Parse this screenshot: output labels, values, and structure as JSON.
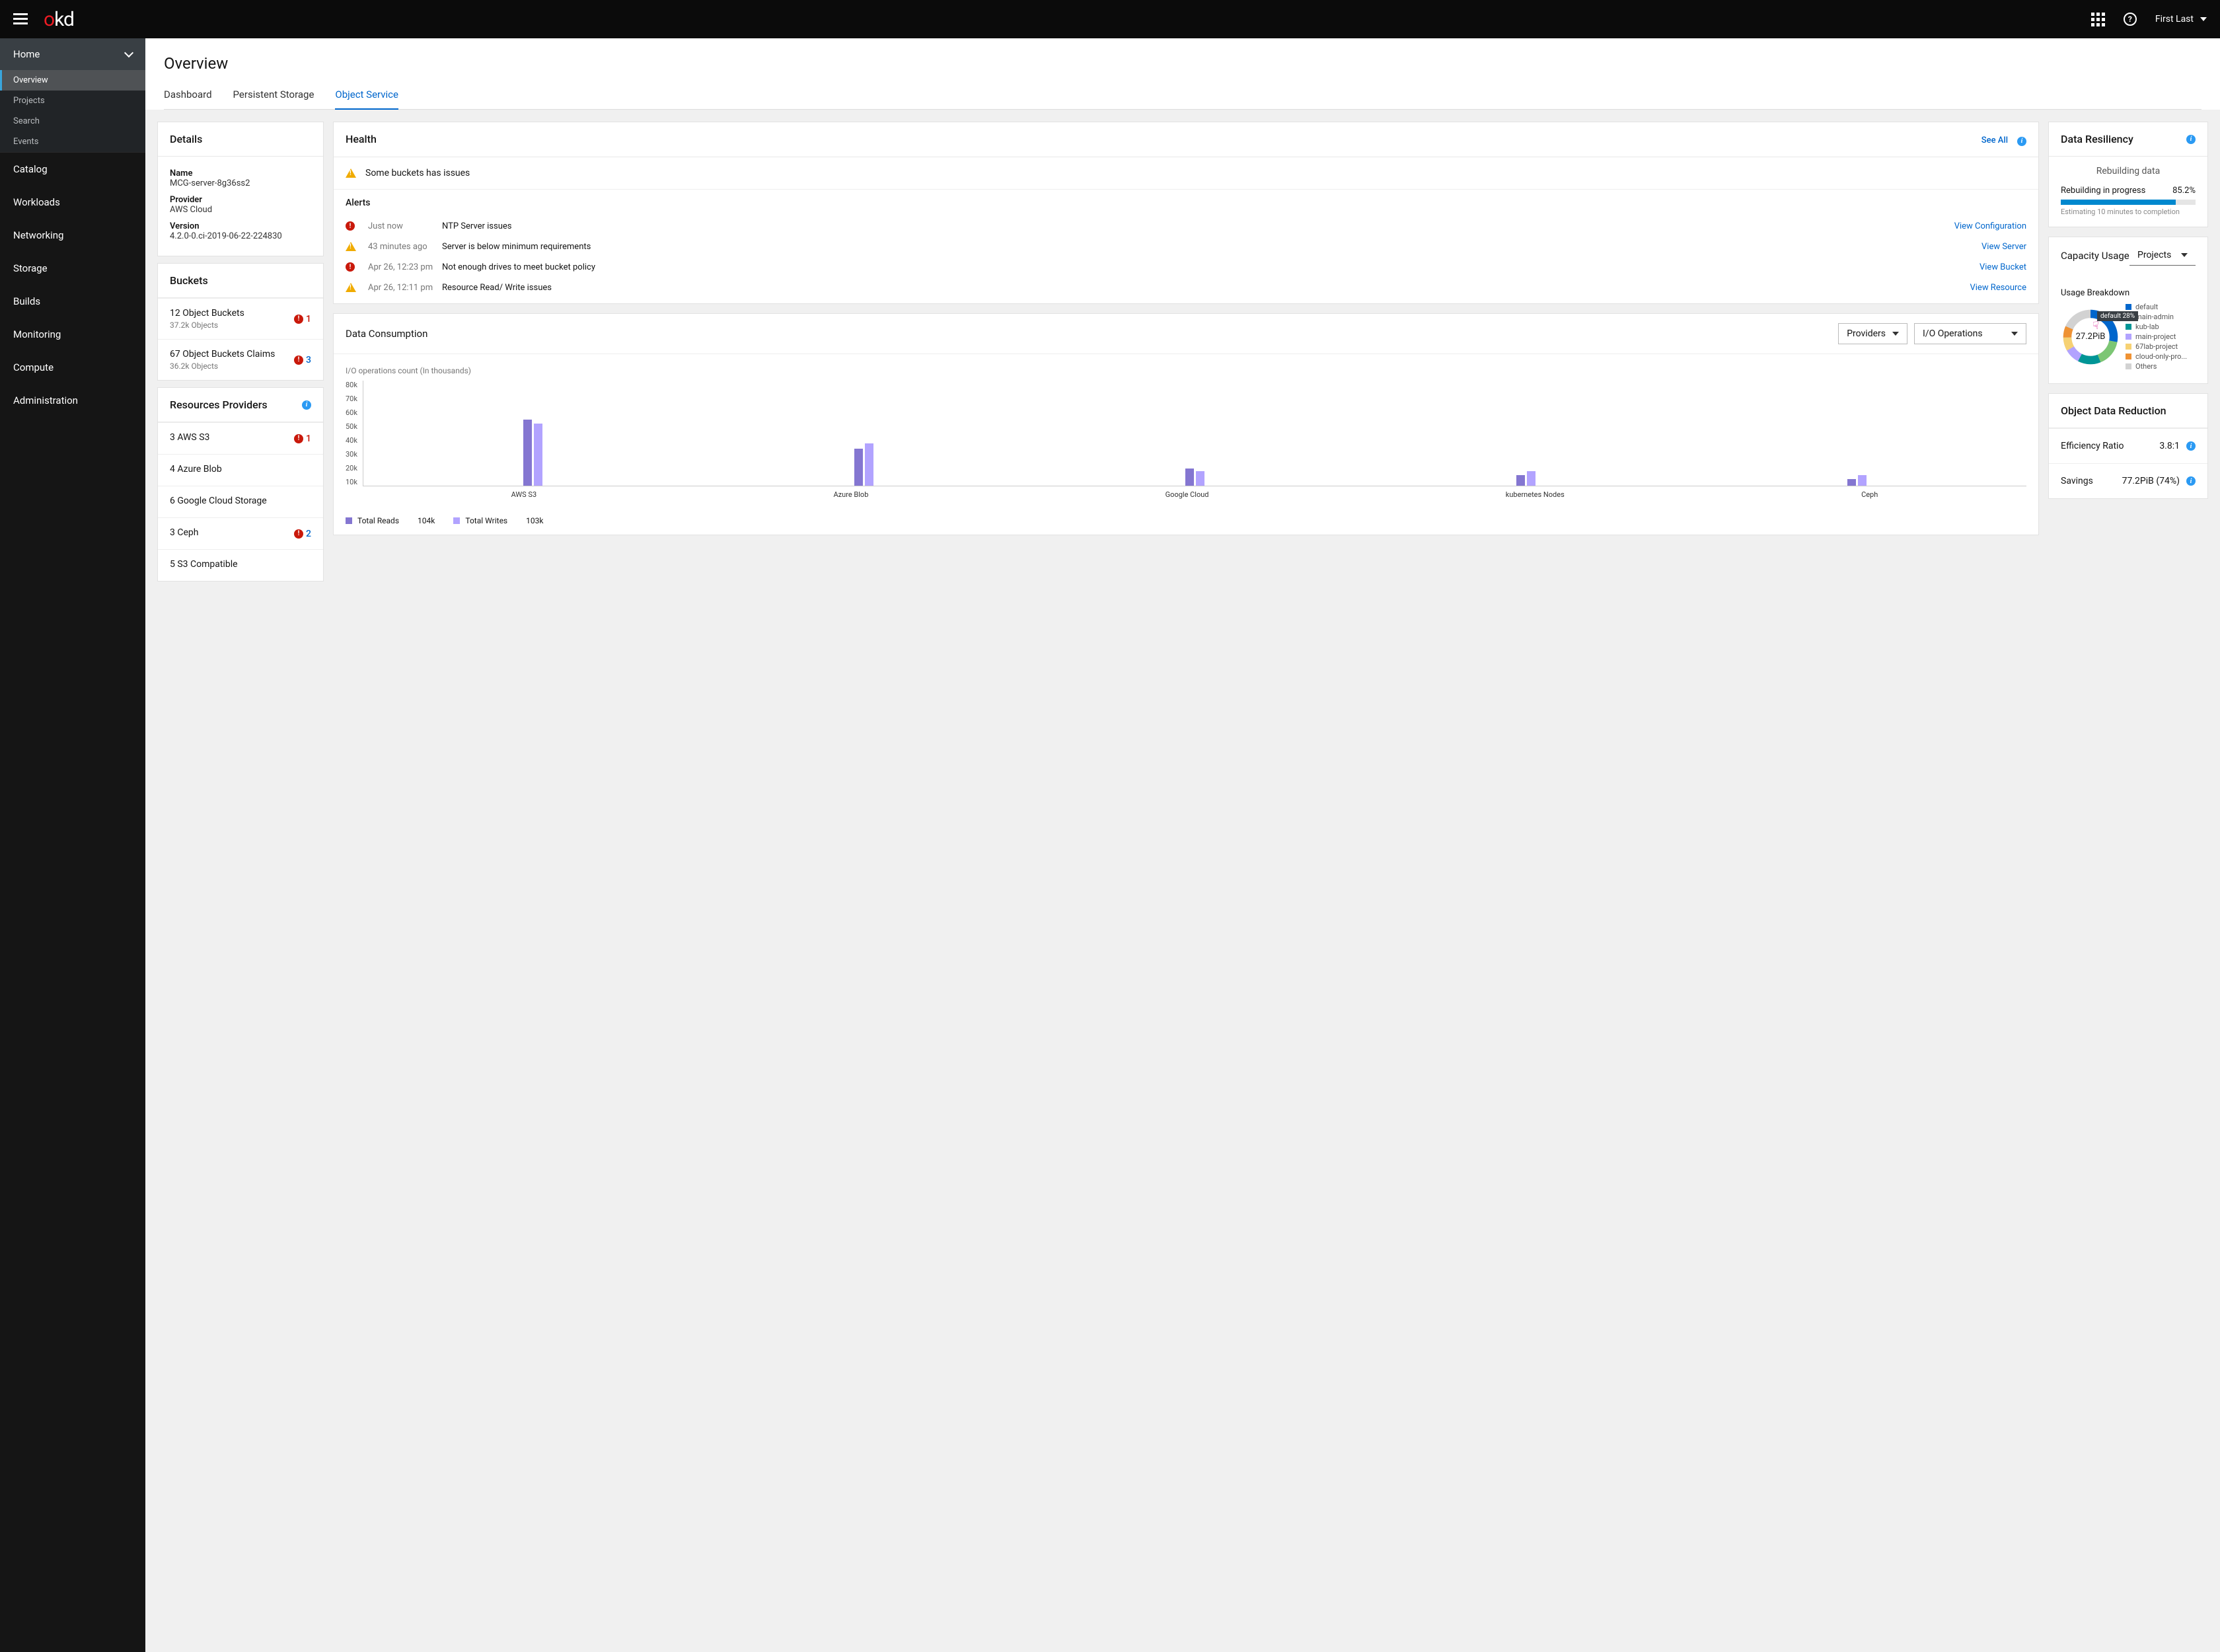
{
  "topbar": {
    "logo_o": "o",
    "logo_kd": "kd",
    "help_glyph": "?",
    "user_name": "First Last"
  },
  "sidebar": {
    "home": "Home",
    "sub": [
      "Overview",
      "Projects",
      "Search",
      "Events"
    ],
    "items": [
      "Catalog",
      "Workloads",
      "Networking",
      "Storage",
      "Builds",
      "Monitoring",
      "Compute",
      "Administration"
    ]
  },
  "page": {
    "title": "Overview"
  },
  "tabs": [
    "Dashboard",
    "Persistent Storage",
    "Object Service"
  ],
  "details": {
    "heading": "Details",
    "name_label": "Name",
    "name_value": "MCG-server-8g36ss2",
    "provider_label": "Provider",
    "provider_value": "AWS Cloud",
    "version_label": "Version",
    "version_value": "4.2.0-0.ci-2019-06-22-224830"
  },
  "buckets": {
    "heading": "Buckets",
    "items": [
      {
        "title": "12 Object Buckets",
        "meta": "37.2k Objects",
        "issues": 1,
        "severity": "error"
      },
      {
        "title": "67 Object Buckets Claims",
        "meta": "36.2k Objects",
        "issues": 3,
        "severity": "error"
      }
    ]
  },
  "providers": {
    "heading": "Resources Providers",
    "items": [
      {
        "title": "3 AWS S3",
        "issues": 1
      },
      {
        "title": "4 Azure Blob"
      },
      {
        "title": "6 Google Cloud Storage"
      },
      {
        "title": "3 Ceph",
        "issues": 2
      },
      {
        "title": "5 S3 Compatible"
      }
    ]
  },
  "health": {
    "heading": "Health",
    "see_all": "See All",
    "summary": "Some buckets has issues",
    "alerts_heading": "Alerts",
    "alerts": [
      {
        "severity": "error",
        "time": "Just now",
        "text": "NTP Server issues",
        "action": "View Configuration"
      },
      {
        "severity": "warn",
        "time": "43 minutes ago",
        "text": "Server is below minimum requirements",
        "action": "View Server"
      },
      {
        "severity": "error",
        "time": "Apr 26, 12:23 pm",
        "text": "Not enough drives to meet bucket policy",
        "action": "View Bucket"
      },
      {
        "severity": "warn",
        "time": "Apr 26, 12:11 pm",
        "text": "Resource Read/ Write issues",
        "action": "View Resource"
      }
    ]
  },
  "consumption": {
    "heading": "Data Consumption",
    "dd1": "Providers",
    "dd2": "I/O Operations",
    "subtitle": "I/O operations count (In thousands)",
    "legend_reads": "Total Reads",
    "legend_reads_val": "104k",
    "legend_writes": "Total Writes",
    "legend_writes_val": "103k",
    "ylabels": [
      "80k",
      "70k",
      "60k",
      "50k",
      "40k",
      "30k",
      "20k",
      "10k"
    ]
  },
  "chart_data": {
    "type": "bar",
    "categories": [
      "AWS S3",
      "Azure Blob",
      "Google Cloud",
      "kubernetes Nodes",
      "Ceph"
    ],
    "series": [
      {
        "name": "Total Reads",
        "values": [
          50,
          28,
          13,
          8,
          5
        ],
        "color": "#8476d1"
      },
      {
        "name": "Total Writes",
        "values": [
          47,
          32,
          11,
          11,
          8
        ],
        "color": "#b2a3ff"
      }
    ],
    "ylabel": "I/O operations count (In thousands)",
    "ylim": [
      0,
      80
    ]
  },
  "resiliency": {
    "heading": "Data Resiliency",
    "status": "Rebuilding data",
    "progress_label": "Rebuilding in progress",
    "progress_value": "85.2%",
    "progress_pct": 85.2,
    "estimate": "Estimating 10 minutes to completion"
  },
  "capacity": {
    "heading": "Capacity Usage",
    "dd": "Projects",
    "breakdown_label": "Usage Breakdown",
    "total": "27.2PiB",
    "tooltip": "default   28%",
    "legend": [
      {
        "label": "default",
        "color": "#0066cc"
      },
      {
        "label": "main-admin",
        "color": "#7cc674"
      },
      {
        "label": "kub-lab",
        "color": "#009596"
      },
      {
        "label": "main-project",
        "color": "#b2a3ff"
      },
      {
        "label": "67lab-project",
        "color": "#f6d173"
      },
      {
        "label": "cloud-only-pro...",
        "color": "#ef9234"
      },
      {
        "label": "Others",
        "color": "#d2d2d2"
      }
    ]
  },
  "reduction": {
    "heading": "Object Data Reduction",
    "eff_label": "Efficiency Ratio",
    "eff_value": "3.8:1",
    "sav_label": "Savings",
    "sav_value": "77.2PiB (74%)"
  }
}
